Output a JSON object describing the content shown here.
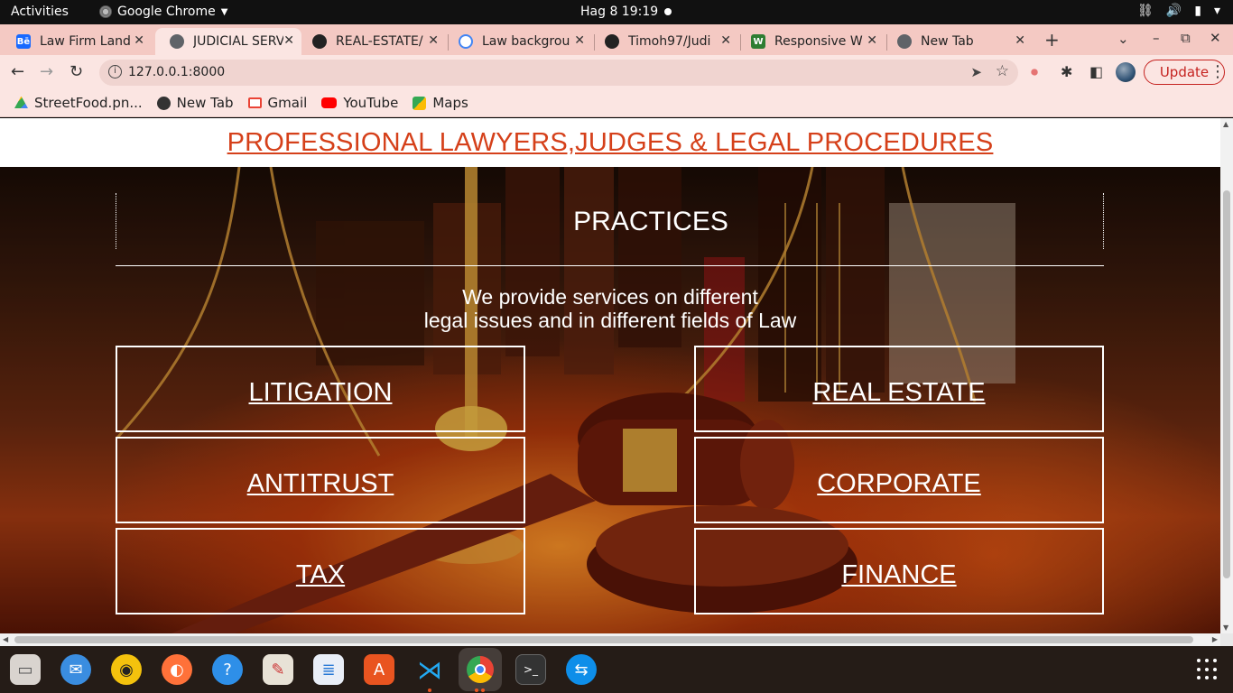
{
  "system_bar": {
    "activities": "Activities",
    "app_name": "Google Chrome",
    "clock": "Hag 8  19:19"
  },
  "tabs": [
    {
      "title": "Law Firm Land",
      "favicon": "behance-icon",
      "color": "#1769ff",
      "active": false
    },
    {
      "title": "JUDICIAL SERV",
      "favicon": "globe-icon",
      "color": "#5f6368",
      "active": true
    },
    {
      "title": "REAL-ESTATE/",
      "favicon": "github-icon",
      "color": "#222222",
      "active": false
    },
    {
      "title": "Law backgrou",
      "favicon": "google-icon",
      "color": "#4285f4",
      "active": false
    },
    {
      "title": "Timoh97/Judi",
      "favicon": "github-icon",
      "color": "#222222",
      "active": false
    },
    {
      "title": "Responsive W",
      "favicon": "w-icon",
      "color": "#2e7d32",
      "active": false
    },
    {
      "title": "New Tab",
      "favicon": "chrome-icon",
      "color": "#5f6368",
      "active": false
    }
  ],
  "address_bar": {
    "url": "127.0.0.1:8000"
  },
  "toolbar": {
    "update_label": "Update"
  },
  "bookmarks": [
    {
      "label": "StreetFood.pn...",
      "icon": "google-drive-icon",
      "color": "#fbbc04"
    },
    {
      "label": "New Tab",
      "icon": "globe-icon",
      "color": "#333333"
    },
    {
      "label": "Gmail",
      "icon": "gmail-icon",
      "color": "#ea4335"
    },
    {
      "label": "YouTube",
      "icon": "youtube-icon",
      "color": "#ff0000"
    },
    {
      "label": "Maps",
      "icon": "maps-icon",
      "color": "#34a853"
    }
  ],
  "page": {
    "header_title": "PROFESSIONAL LAWYERS,JUDGES & LEGAL PROCEDURES",
    "header_color": "#d5401a",
    "section_title": "PRACTICES",
    "description_line1": "We provide services on different",
    "description_line2": "legal issues and in different fields of Law",
    "practice_areas": [
      {
        "label": "LITIGATION"
      },
      {
        "label": "REAL ESTATE"
      },
      {
        "label": "ANTITRUST"
      },
      {
        "label": "CORPORATE"
      },
      {
        "label": "TAX"
      },
      {
        "label": "FINANCE"
      }
    ]
  },
  "dock": [
    {
      "name": "files-icon",
      "color": "#d9d4cf"
    },
    {
      "name": "thunderbird-icon",
      "color": "#3a8de0"
    },
    {
      "name": "rhythmbox-icon",
      "color": "#f4c20d"
    },
    {
      "name": "firefox-icon",
      "color": "#ff7139"
    },
    {
      "name": "help-icon",
      "color": "#2e8fe8"
    },
    {
      "name": "text-editor-icon",
      "color": "#e8e2d6"
    },
    {
      "name": "libreoffice-writer-icon",
      "color": "#2a7ad6"
    },
    {
      "name": "app-center-icon",
      "color": "#e95420"
    },
    {
      "name": "vscode-icon",
      "color": "#23a9f2"
    },
    {
      "name": "chrome-icon",
      "color": "#4285f4"
    },
    {
      "name": "terminal-icon",
      "color": "#333333"
    },
    {
      "name": "teamviewer-icon",
      "color": "#0e8ee9"
    }
  ]
}
